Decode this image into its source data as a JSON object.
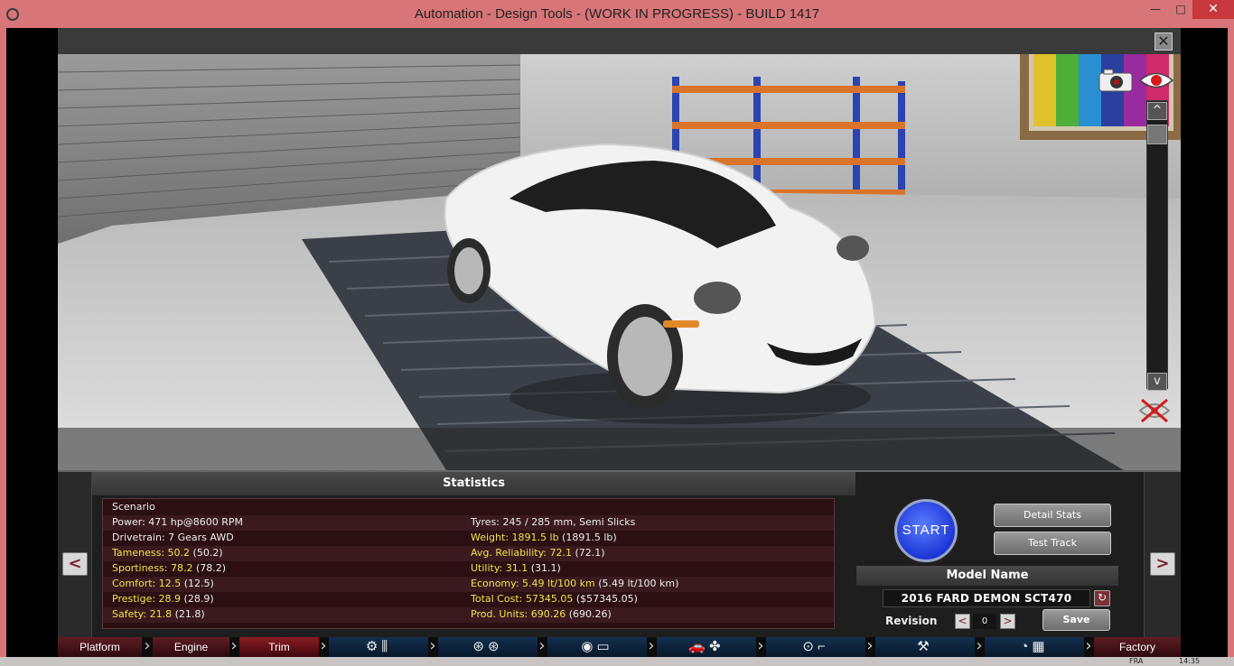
{
  "window": {
    "title": "Automation - Design Tools - (WORK IN PROGRESS) - BUILD 1417",
    "minimize_label": "—",
    "maximize_label": "□",
    "close_label": "✕"
  },
  "viewport": {
    "close_label": "✕",
    "scroll_up_label": "^",
    "scroll_down_label": "v",
    "car_color": "#f2f2f2"
  },
  "statistics": {
    "title": "Statistics",
    "rows": [
      {
        "left_label": "Scenario",
        "left_value": "",
        "left_paren": "",
        "right_label": "",
        "right_value": "",
        "right_paren": ""
      },
      {
        "left_label": "Power: 471 hp@8600 RPM",
        "left_value": "",
        "left_paren": "",
        "right_label": "Tyres: 245 / 285 mm, Semi Slicks",
        "right_value": "",
        "right_paren": ""
      },
      {
        "left_label": "Drivetrain: 7 Gears AWD",
        "left_value": "",
        "left_paren": "",
        "right_label": "Weight: 1891.5 lb",
        "right_value": "",
        "right_paren": " (1891.5 lb)"
      },
      {
        "left_label": "Tameness: 50.2",
        "left_value": "",
        "left_paren": " (50.2)",
        "right_label": "Avg. Reliability: 72.1",
        "right_value": "",
        "right_paren": " (72.1)"
      },
      {
        "left_label": "Sportiness: 78.2",
        "left_value": "",
        "left_paren": " (78.2)",
        "right_label": "Utility: 31.1",
        "right_value": "",
        "right_paren": " (31.1)"
      },
      {
        "left_label": "Comfort: 12.5",
        "left_value": "",
        "left_paren": " (12.5)",
        "right_label": "Economy: 5.49 lt/100 km",
        "right_value": "",
        "right_paren": " (5.49 lt/100 km)"
      },
      {
        "left_label": "Prestige: 28.9",
        "left_value": "",
        "left_paren": " (28.9)",
        "right_label": "Total Cost: 57345.05",
        "right_value": "",
        "right_paren": " ($57345.05)"
      },
      {
        "left_label": "Safety: 21.8",
        "left_value": "",
        "left_paren": " (21.8)",
        "right_label": "Prod. Units: 690.26",
        "right_value": "",
        "right_paren": " (690.26)"
      }
    ]
  },
  "controls": {
    "start_label": "START",
    "detail_stats_label": "Detail Stats",
    "test_track_label": "Test Track",
    "model_name_header": "Model Name",
    "model_name_value": "2016 FARD DEMON SCT470",
    "revision_label": "Revision",
    "revision_value": "0",
    "revision_decrement": "<",
    "revision_increment": ">",
    "save_label": "Save",
    "prev_label": "<",
    "next_label": ">"
  },
  "tabs": {
    "platform": "Platform",
    "engine": "Engine",
    "trim": "Trim",
    "factory": "Factory"
  },
  "taskbar": {
    "language": "FRA",
    "clock": "14:35"
  },
  "colors": {
    "titlebar": "#d77578",
    "accent_red": "#7a1f2a",
    "highlight_yellow": "#f2e24a",
    "start_blue": "#1c36d6"
  }
}
